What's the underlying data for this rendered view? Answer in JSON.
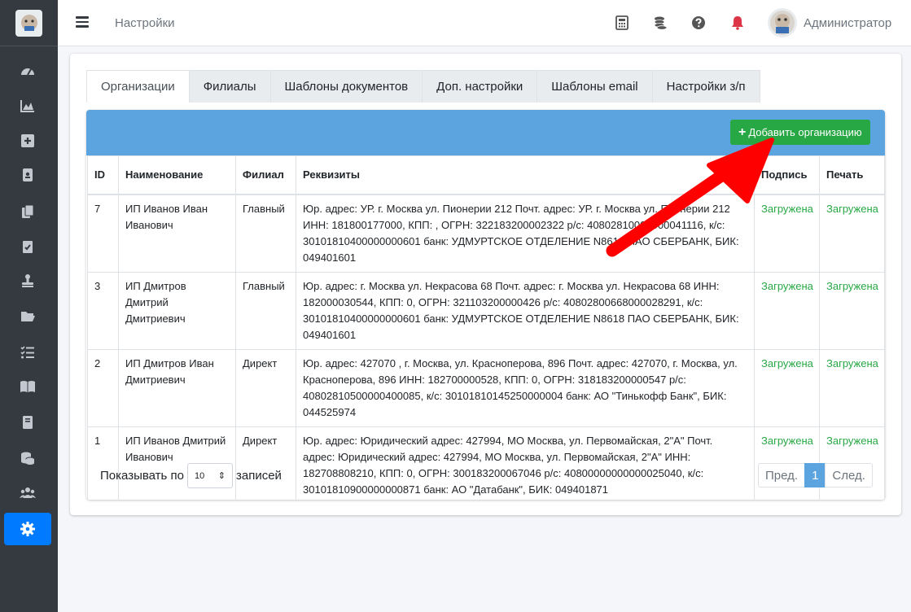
{
  "topbar": {
    "title": "Настройки",
    "user_name": "Администратор"
  },
  "tabs": [
    {
      "label": "Организации"
    },
    {
      "label": "Филиалы"
    },
    {
      "label": "Шаблоны документов"
    },
    {
      "label": "Доп. настройки"
    },
    {
      "label": "Шаблоны email"
    },
    {
      "label": "Настройки з/п"
    }
  ],
  "add_button": "Добавить организацию",
  "table": {
    "headers": {
      "id": "ID",
      "name": "Наименование",
      "branch": "Филиал",
      "details": "Реквизиты",
      "signature": "Подпись",
      "stamp": "Печать"
    },
    "rows": [
      {
        "id": "7",
        "name": "ИП Иванов Иван Иванович",
        "branch": "Главный",
        "details": "Юр. адрес: УР. г. Москва ул. Пионерии 212 Почт. адрес: УР. г. Москва ул. Пионерии 212 ИНН: 181800177000, КПП: , ОГРН: 322183200002322 р/с: 40802810008000041116, к/с: 30101810400000000601 банк: УДМУРТСКОЕ ОТДЕЛЕНИЕ N8618 ПАО СБЕРБАНК, БИК: 049401601",
        "signature": "Загружена",
        "stamp": "Загружена"
      },
      {
        "id": "3",
        "name": "ИП Дмитров Дмитрий Дмитриевич",
        "branch": "Главный",
        "details": "Юр. адрес: г. Москва ул. Некрасова 68 Почт. адрес: г. Москва ул. Некрасова 68 ИНН: 182000030544, КПП: 0, ОГРН: 321103200000426 р/с: 40802800668000028291, к/с: 30101810400000000601 банк: УДМУРТСКОЕ ОТДЕЛЕНИЕ N8618 ПАО СБЕРБАНК, БИК: 049401601",
        "signature": "Загружена",
        "stamp": "Загружена"
      },
      {
        "id": "2",
        "name": "ИП Дмитров Иван Дмитриевич",
        "branch": "Директ",
        "details": "Юр. адрес: 427070 , г. Москва, ул. Красноперова, 896 Почт. адрес: 427070, г. Москва, ул. Красноперова, 896 ИНН: 182700000528, КПП: 0, ОГРН: 318183200000547 р/с: 40802810500000400085, к/с: 30101810145250000004 банк: АО \"Тинькофф Банк\", БИК: 044525974",
        "signature": "Загружена",
        "stamp": "Загружена"
      },
      {
        "id": "1",
        "name": "ИП Иванов Дмитрий Иванович",
        "branch": "Директ",
        "details": "Юр. адрес: Юридический адрес: 427994, МО Москва, ул. Первомайская, 2\"А\" Почт. адрес: Юридический адрес: 427994, МО Москва, ул. Первомайская, 2\"А\" ИНН: 182708808210, КПП: 0, ОГРН: 300183200067046 р/с: 40800000000000025040, к/с: 30101810900000000871 банк: АО \"Датабанк\", БИК: 049401871",
        "signature": "Загружена",
        "stamp": "Загружена"
      }
    ]
  },
  "footer": {
    "show_prefix": "Показывать по",
    "per_page": "10",
    "show_suffix": "записей",
    "prev": "Пред.",
    "page": "1",
    "next": "След."
  },
  "colors": {
    "sidebar": "#343a40",
    "active": "#007bff",
    "header_band": "#5ba4e0",
    "success": "#28a745",
    "arrow": "#ff0000"
  }
}
